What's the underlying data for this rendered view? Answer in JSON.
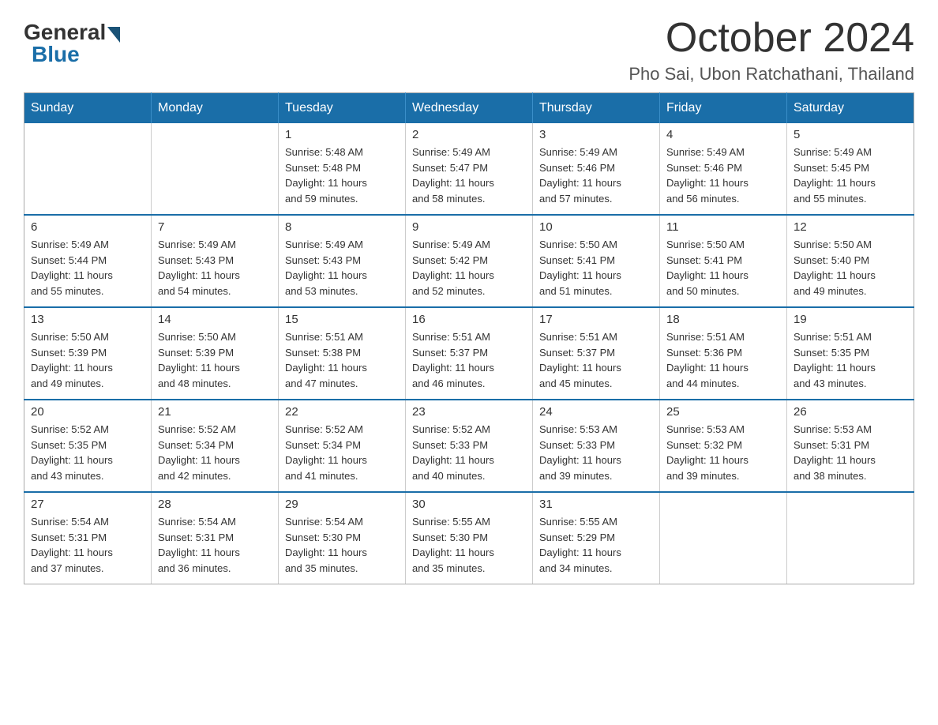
{
  "header": {
    "logo": {
      "general": "General",
      "blue": "Blue"
    },
    "month": "October 2024",
    "location": "Pho Sai, Ubon Ratchathani, Thailand"
  },
  "weekdays": [
    "Sunday",
    "Monday",
    "Tuesday",
    "Wednesday",
    "Thursday",
    "Friday",
    "Saturday"
  ],
  "weeks": [
    [
      {
        "day": "",
        "info": ""
      },
      {
        "day": "",
        "info": ""
      },
      {
        "day": "1",
        "info": "Sunrise: 5:48 AM\nSunset: 5:48 PM\nDaylight: 11 hours\nand 59 minutes."
      },
      {
        "day": "2",
        "info": "Sunrise: 5:49 AM\nSunset: 5:47 PM\nDaylight: 11 hours\nand 58 minutes."
      },
      {
        "day": "3",
        "info": "Sunrise: 5:49 AM\nSunset: 5:46 PM\nDaylight: 11 hours\nand 57 minutes."
      },
      {
        "day": "4",
        "info": "Sunrise: 5:49 AM\nSunset: 5:46 PM\nDaylight: 11 hours\nand 56 minutes."
      },
      {
        "day": "5",
        "info": "Sunrise: 5:49 AM\nSunset: 5:45 PM\nDaylight: 11 hours\nand 55 minutes."
      }
    ],
    [
      {
        "day": "6",
        "info": "Sunrise: 5:49 AM\nSunset: 5:44 PM\nDaylight: 11 hours\nand 55 minutes."
      },
      {
        "day": "7",
        "info": "Sunrise: 5:49 AM\nSunset: 5:43 PM\nDaylight: 11 hours\nand 54 minutes."
      },
      {
        "day": "8",
        "info": "Sunrise: 5:49 AM\nSunset: 5:43 PM\nDaylight: 11 hours\nand 53 minutes."
      },
      {
        "day": "9",
        "info": "Sunrise: 5:49 AM\nSunset: 5:42 PM\nDaylight: 11 hours\nand 52 minutes."
      },
      {
        "day": "10",
        "info": "Sunrise: 5:50 AM\nSunset: 5:41 PM\nDaylight: 11 hours\nand 51 minutes."
      },
      {
        "day": "11",
        "info": "Sunrise: 5:50 AM\nSunset: 5:41 PM\nDaylight: 11 hours\nand 50 minutes."
      },
      {
        "day": "12",
        "info": "Sunrise: 5:50 AM\nSunset: 5:40 PM\nDaylight: 11 hours\nand 49 minutes."
      }
    ],
    [
      {
        "day": "13",
        "info": "Sunrise: 5:50 AM\nSunset: 5:39 PM\nDaylight: 11 hours\nand 49 minutes."
      },
      {
        "day": "14",
        "info": "Sunrise: 5:50 AM\nSunset: 5:39 PM\nDaylight: 11 hours\nand 48 minutes."
      },
      {
        "day": "15",
        "info": "Sunrise: 5:51 AM\nSunset: 5:38 PM\nDaylight: 11 hours\nand 47 minutes."
      },
      {
        "day": "16",
        "info": "Sunrise: 5:51 AM\nSunset: 5:37 PM\nDaylight: 11 hours\nand 46 minutes."
      },
      {
        "day": "17",
        "info": "Sunrise: 5:51 AM\nSunset: 5:37 PM\nDaylight: 11 hours\nand 45 minutes."
      },
      {
        "day": "18",
        "info": "Sunrise: 5:51 AM\nSunset: 5:36 PM\nDaylight: 11 hours\nand 44 minutes."
      },
      {
        "day": "19",
        "info": "Sunrise: 5:51 AM\nSunset: 5:35 PM\nDaylight: 11 hours\nand 43 minutes."
      }
    ],
    [
      {
        "day": "20",
        "info": "Sunrise: 5:52 AM\nSunset: 5:35 PM\nDaylight: 11 hours\nand 43 minutes."
      },
      {
        "day": "21",
        "info": "Sunrise: 5:52 AM\nSunset: 5:34 PM\nDaylight: 11 hours\nand 42 minutes."
      },
      {
        "day": "22",
        "info": "Sunrise: 5:52 AM\nSunset: 5:34 PM\nDaylight: 11 hours\nand 41 minutes."
      },
      {
        "day": "23",
        "info": "Sunrise: 5:52 AM\nSunset: 5:33 PM\nDaylight: 11 hours\nand 40 minutes."
      },
      {
        "day": "24",
        "info": "Sunrise: 5:53 AM\nSunset: 5:33 PM\nDaylight: 11 hours\nand 39 minutes."
      },
      {
        "day": "25",
        "info": "Sunrise: 5:53 AM\nSunset: 5:32 PM\nDaylight: 11 hours\nand 39 minutes."
      },
      {
        "day": "26",
        "info": "Sunrise: 5:53 AM\nSunset: 5:31 PM\nDaylight: 11 hours\nand 38 minutes."
      }
    ],
    [
      {
        "day": "27",
        "info": "Sunrise: 5:54 AM\nSunset: 5:31 PM\nDaylight: 11 hours\nand 37 minutes."
      },
      {
        "day": "28",
        "info": "Sunrise: 5:54 AM\nSunset: 5:31 PM\nDaylight: 11 hours\nand 36 minutes."
      },
      {
        "day": "29",
        "info": "Sunrise: 5:54 AM\nSunset: 5:30 PM\nDaylight: 11 hours\nand 35 minutes."
      },
      {
        "day": "30",
        "info": "Sunrise: 5:55 AM\nSunset: 5:30 PM\nDaylight: 11 hours\nand 35 minutes."
      },
      {
        "day": "31",
        "info": "Sunrise: 5:55 AM\nSunset: 5:29 PM\nDaylight: 11 hours\nand 34 minutes."
      },
      {
        "day": "",
        "info": ""
      },
      {
        "day": "",
        "info": ""
      }
    ]
  ]
}
